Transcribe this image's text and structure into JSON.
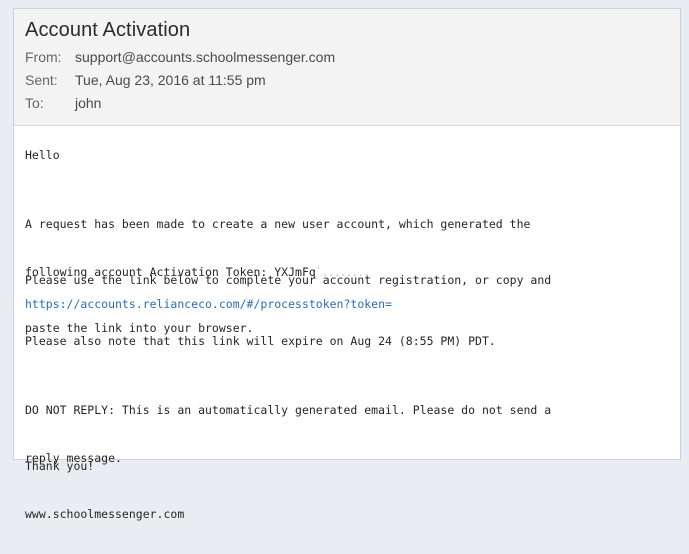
{
  "email": {
    "subject": "Account Activation",
    "from_label": "From:",
    "from_value": "support@accounts.schoolmessenger.com",
    "sent_label": "Sent:",
    "sent_value": "Tue, Aug 23, 2016 at 11:55 pm",
    "to_label": "To:",
    "to_value": "john"
  },
  "body": {
    "greeting": "Hello",
    "request_line1": "A request has been made to create a new user account, which generated the",
    "request_line2_prefix": "following account Activation Token: YXJmFq",
    "link_intro_line1": "Please use the link below to complete your account registration, or copy and",
    "link_intro_line2": "paste the link into your browser.",
    "link_text": "https://accounts.relianceco.com/#/processtoken?token=",
    "expire_line": "Please also note that this link will expire on Aug 24 (8:55 PM) PDT.",
    "noreply_line1": "DO NOT REPLY: This is an automatically generated email. Please do not send a",
    "noreply_line2": "reply message.",
    "thanks": "Thank you!",
    "website": "www.schoolmessenger.com"
  }
}
